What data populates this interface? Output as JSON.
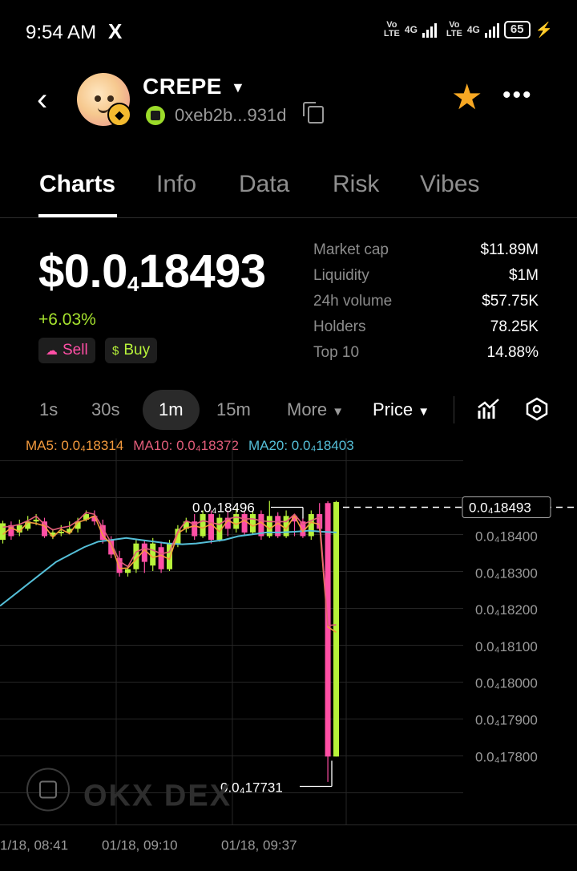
{
  "status_bar": {
    "time": "9:54 AM",
    "x_icon": "X",
    "network1": "Vo\nLTE",
    "sim1": "4G",
    "network2": "Vo\nLTE",
    "sim2": "4G",
    "battery": "65"
  },
  "header": {
    "token_name": "CREPE",
    "address": "0xeb2b...931d",
    "chain_badge": "BNB",
    "favorite_icon": "star-icon",
    "favorite_color": "#f7a823"
  },
  "tabs": [
    {
      "label": "Charts",
      "active": true
    },
    {
      "label": "Info"
    },
    {
      "label": "Data"
    },
    {
      "label": "Risk"
    },
    {
      "label": "Vibes"
    }
  ],
  "price": {
    "prefix": "$0.0",
    "zeros": "4",
    "digits": "18493",
    "change": "+6.03%",
    "change_color": "#a6e22e",
    "sell_label": "Sell",
    "buy_label": "Buy"
  },
  "stats": [
    {
      "label": "Market cap",
      "value": "$11.89M"
    },
    {
      "label": "Liquidity",
      "value": "$1M"
    },
    {
      "label": "24h volume",
      "value": "$57.75K"
    },
    {
      "label": "Holders",
      "value": "78.25K"
    },
    {
      "label": "Top 10",
      "value": "14.88%"
    }
  ],
  "intervals": {
    "items": [
      "1s",
      "30s",
      "1m",
      "15m"
    ],
    "active": "1m",
    "more_label": "More",
    "price_label": "Price"
  },
  "ma": {
    "ma5": "MA5: 0.0₄18314",
    "ma10": "MA10: 0.0₄18372",
    "ma20": "MA20: 0.0₄18403"
  },
  "chart_data": {
    "type": "candlestick",
    "y_ticks": [
      "0.0₄18400",
      "0.0₄18300",
      "0.0₄18200",
      "0.0₄18100",
      "0.0₄18000",
      "0.0₄17900",
      "0.0₄17800"
    ],
    "y_tick_values": [
      1.84e-05,
      1.83e-05,
      1.82e-05,
      1.81e-05,
      1.8e-05,
      1.79e-05,
      1.78e-05
    ],
    "x_ticks": [
      "1/18, 08:41",
      "01/18, 09:10",
      "01/18, 09:37"
    ],
    "current_price_label": "0.0₄18493",
    "high_label": "0.0₄18496",
    "low_label": "0.0₄17731",
    "current": 1.8493e-05,
    "high": 1.8496e-05,
    "low": 1.7731e-05,
    "colors": {
      "up": "#b7f23a",
      "down": "#ff4fa5",
      "ma5": "#f39a3d",
      "ma10": "#e25d7a",
      "ma20": "#55bfd8"
    },
    "candles": [
      {
        "o": 18390,
        "c": 18435,
        "h": 18442,
        "l": 18380
      },
      {
        "o": 18430,
        "c": 18400,
        "h": 18440,
        "l": 18390
      },
      {
        "o": 18410,
        "c": 18430,
        "h": 18445,
        "l": 18400
      },
      {
        "o": 18420,
        "c": 18440,
        "h": 18455,
        "l": 18415
      },
      {
        "o": 18440,
        "c": 18445,
        "h": 18460,
        "l": 18430
      },
      {
        "o": 18440,
        "c": 18400,
        "h": 18450,
        "l": 18395
      },
      {
        "o": 18400,
        "c": 18410,
        "h": 18420,
        "l": 18392
      },
      {
        "o": 18410,
        "c": 18412,
        "h": 18430,
        "l": 18400
      },
      {
        "o": 18410,
        "c": 18420,
        "h": 18440,
        "l": 18405
      },
      {
        "o": 18420,
        "c": 18440,
        "h": 18450,
        "l": 18410
      },
      {
        "o": 18445,
        "c": 18460,
        "h": 18470,
        "l": 18440
      },
      {
        "o": 18455,
        "c": 18440,
        "h": 18470,
        "l": 18430
      },
      {
        "o": 18430,
        "c": 18390,
        "h": 18445,
        "l": 18380
      },
      {
        "o": 18390,
        "c": 18350,
        "h": 18400,
        "l": 18340
      },
      {
        "o": 18340,
        "c": 18300,
        "h": 18360,
        "l": 18290
      },
      {
        "o": 18300,
        "c": 18310,
        "h": 18320,
        "l": 18290
      },
      {
        "o": 18310,
        "c": 18380,
        "h": 18390,
        "l": 18300
      },
      {
        "o": 18380,
        "c": 18330,
        "h": 18390,
        "l": 18300
      },
      {
        "o": 18320,
        "c": 18380,
        "h": 18395,
        "l": 18305
      },
      {
        "o": 18370,
        "c": 18310,
        "h": 18385,
        "l": 18300
      },
      {
        "o": 18310,
        "c": 18380,
        "h": 18390,
        "l": 18305
      },
      {
        "o": 18380,
        "c": 18420,
        "h": 18430,
        "l": 18370
      },
      {
        "o": 18420,
        "c": 18440,
        "h": 18450,
        "l": 18410
      },
      {
        "o": 18440,
        "c": 18400,
        "h": 18460,
        "l": 18390
      },
      {
        "o": 18400,
        "c": 18460,
        "h": 18470,
        "l": 18395
      },
      {
        "o": 18460,
        "c": 18390,
        "h": 18470,
        "l": 18380
      },
      {
        "o": 18390,
        "c": 18450,
        "h": 18460,
        "l": 18385
      },
      {
        "o": 18450,
        "c": 18420,
        "h": 18470,
        "l": 18400
      },
      {
        "o": 18420,
        "c": 18460,
        "h": 18475,
        "l": 18410
      },
      {
        "o": 18460,
        "c": 18410,
        "h": 18470,
        "l": 18400
      },
      {
        "o": 18410,
        "c": 18460,
        "h": 18470,
        "l": 18405
      },
      {
        "o": 18460,
        "c": 18400,
        "h": 18470,
        "l": 18390
      },
      {
        "o": 18400,
        "c": 18455,
        "h": 18496,
        "l": 18395
      },
      {
        "o": 18455,
        "c": 18400,
        "h": 18465,
        "l": 18395
      },
      {
        "o": 18400,
        "c": 18455,
        "h": 18470,
        "l": 18395
      },
      {
        "o": 18455,
        "c": 18440,
        "h": 18460,
        "l": 18400
      },
      {
        "o": 18440,
        "c": 18400,
        "h": 18450,
        "l": 18395
      },
      {
        "o": 18400,
        "c": 18460,
        "h": 18470,
        "l": 18390
      },
      {
        "o": 18460,
        "c": 18420,
        "h": 18490,
        "l": 18410
      },
      {
        "o": 18490,
        "c": 17800,
        "h": 18495,
        "l": 17731
      },
      {
        "o": 17800,
        "c": 18493,
        "h": 18496,
        "l": 17800
      }
    ],
    "ma20_path": [
      18210,
      18240,
      18270,
      18300,
      18330,
      18350,
      18370,
      18385,
      18390,
      18395,
      18390,
      18385,
      18380,
      18378,
      18380,
      18385,
      18390,
      18400,
      18405,
      18410,
      18410,
      18412,
      18415,
      18412,
      18410
    ],
    "watermark": "OKX DEX"
  }
}
